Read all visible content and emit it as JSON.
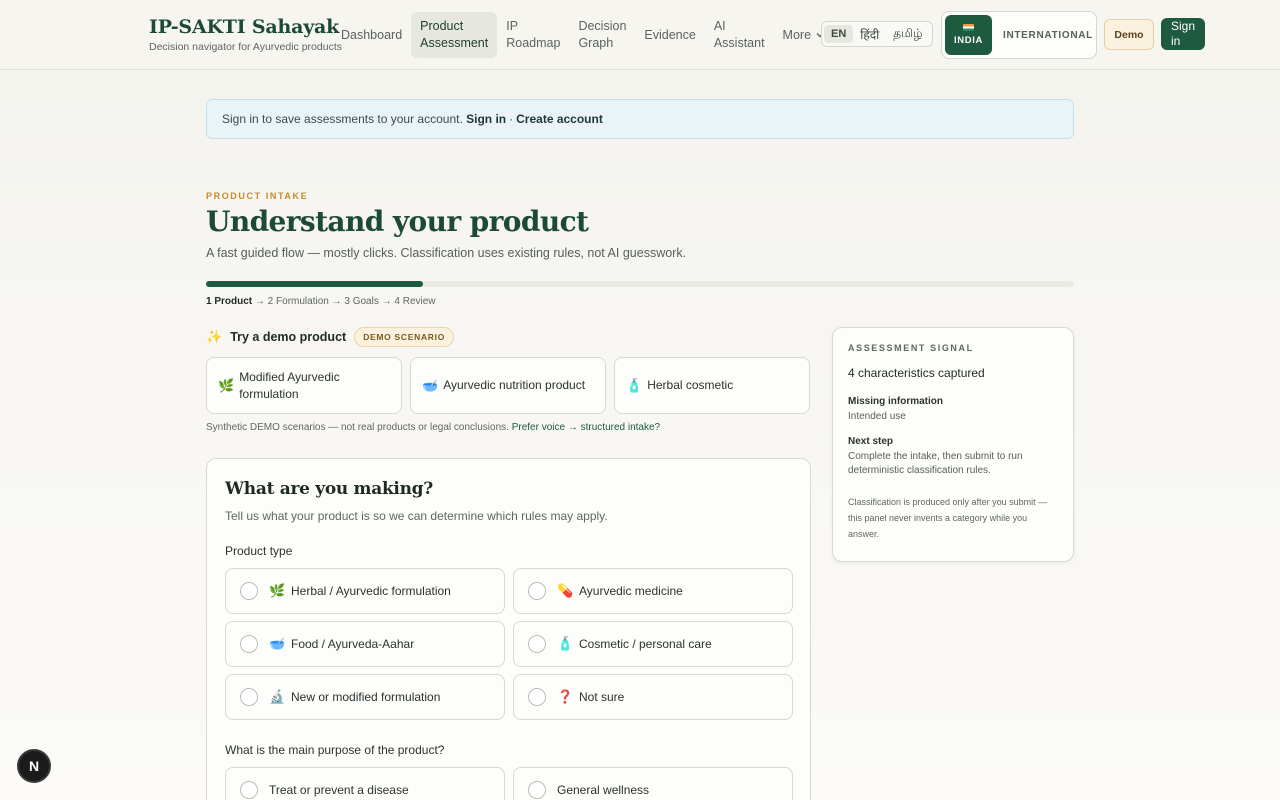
{
  "app": {
    "title": "IP-SAKTI Sahayak",
    "subtitle": "Decision navigator for Ayurvedic products"
  },
  "nav": {
    "items": [
      {
        "label": "Dashboard"
      },
      {
        "label": "Product\nAssessment",
        "active": true
      },
      {
        "label": "IP\nRoadmap"
      },
      {
        "label": "Decision\nGraph"
      },
      {
        "label": "Evidence"
      },
      {
        "label": "AI\nAssistant"
      }
    ],
    "more_label": "More",
    "languages": [
      "EN",
      "हिंदी",
      "தமிழ்"
    ],
    "selected_language": "EN",
    "region_india": "INDIA",
    "region_international": "INTERNATIONAL",
    "demo_label": "Demo",
    "signin_label": "Sign\nin"
  },
  "banner": {
    "text": "Sign in to save assessments to your account.",
    "signin_link": "Sign in",
    "separator": "·",
    "create_link": "Create account"
  },
  "intake": {
    "eyebrow": "PRODUCT INTAKE",
    "title": "Understand your product",
    "subtitle": "A fast guided flow — mostly clicks. Classification uses existing rules, not AI guesswork.",
    "progress_fraction": 0.25,
    "steps": {
      "current": "1 Product",
      "rest": " → 2 Formulation → 3 Goals → 4 Review"
    }
  },
  "demo": {
    "heading": "Try a demo product",
    "badge": "DEMO SCENARIO",
    "cards": [
      {
        "emoji": "🌿",
        "label": "Modified Ayurvedic formulation"
      },
      {
        "emoji": "🥣",
        "label": "Ayurvedic nutrition product"
      },
      {
        "emoji": "🧴",
        "label": "Herbal cosmetic"
      }
    ],
    "note": "Synthetic DEMO scenarios — not real products or legal conclusions.",
    "voice_link": "Prefer voice → structured intake?"
  },
  "form": {
    "title": "What are you making?",
    "subtitle": "Tell us what your product is so we can determine which rules may apply.",
    "product_type_label": "Product type",
    "product_types": [
      {
        "emoji": "🌿",
        "label": "Herbal / Ayurvedic formulation"
      },
      {
        "emoji": "💊",
        "label": "Ayurvedic medicine"
      },
      {
        "emoji": "🥣",
        "label": "Food / Ayurveda-Aahar"
      },
      {
        "emoji": "🧴",
        "label": "Cosmetic / personal care"
      },
      {
        "emoji": "🔬",
        "label": "New or modified formulation"
      },
      {
        "emoji": "❓",
        "label": "Not sure"
      }
    ],
    "purpose_label": "What is the main purpose of the product?",
    "purposes": [
      {
        "label": "Treat or prevent a disease"
      },
      {
        "label": "General wellness"
      }
    ]
  },
  "signal": {
    "heading": "ASSESSMENT SIGNAL",
    "count": "4 characteristics captured",
    "missing_heading": "Missing information",
    "missing_value": "Intended use",
    "next_heading": "Next step",
    "next_value": "Complete the intake, then submit to run deterministic classification rules.",
    "fine_print": "Classification is produced only after you submit — this panel never invents a category while you answer."
  },
  "fab": {
    "label": "N"
  },
  "colors": {
    "brand": "#1e5a3f",
    "accent": "#c98a2b",
    "banner_bg": "#eaf3f7"
  }
}
